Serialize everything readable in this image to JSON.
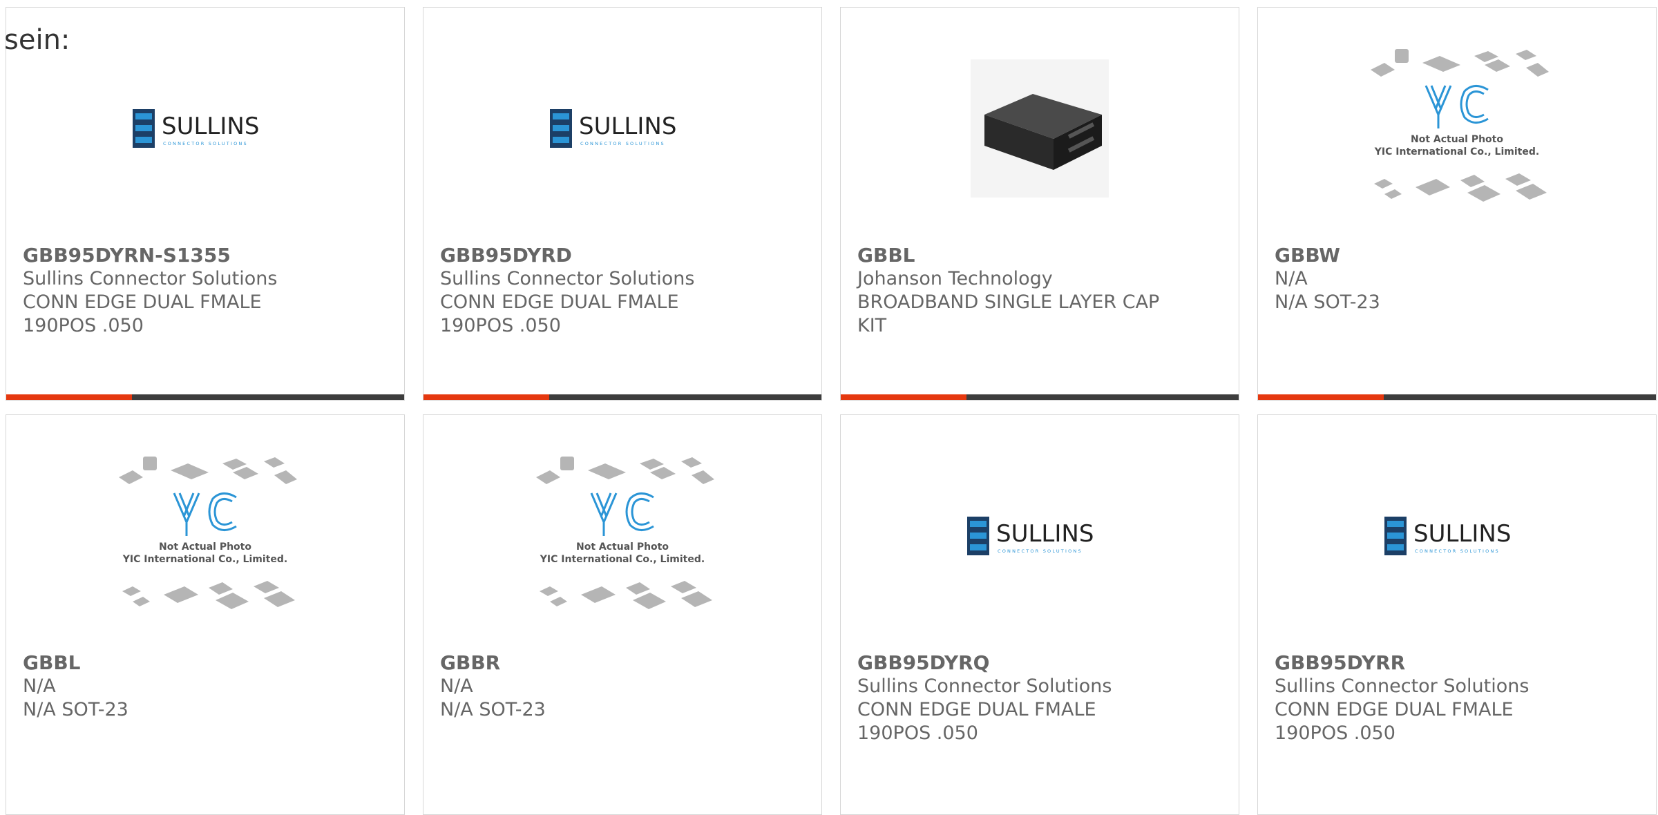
{
  "lead_text": "sein:",
  "products": [
    {
      "part": "GBB95DYRN-S1355",
      "manufacturer": "Sullins Connector Solutions",
      "desc1": "CONN EDGE DUAL FMALE",
      "desc2": "190POS .050",
      "image": "sullins-logo"
    },
    {
      "part": "GBB95DYRD",
      "manufacturer": "Sullins Connector Solutions",
      "desc1": "CONN EDGE DUAL FMALE",
      "desc2": "190POS .050",
      "image": "sullins-logo"
    },
    {
      "part": "GBBL",
      "manufacturer": "Johanson Technology",
      "desc1": "BROADBAND SINGLE LAYER CAP",
      "desc2": "KIT",
      "image": "component-photo"
    },
    {
      "part": "GBBW",
      "manufacturer": "N/A",
      "desc1": "N/A SOT-23",
      "desc2": "",
      "image": "yic-placeholder"
    },
    {
      "part": "GBBL",
      "manufacturer": "N/A",
      "desc1": "N/A SOT-23",
      "desc2": "",
      "image": "yic-placeholder"
    },
    {
      "part": "GBBR",
      "manufacturer": "N/A",
      "desc1": "N/A SOT-23",
      "desc2": "",
      "image": "yic-placeholder"
    },
    {
      "part": "GBB95DYRQ",
      "manufacturer": "Sullins Connector Solutions",
      "desc1": "CONN EDGE DUAL FMALE",
      "desc2": "190POS .050",
      "image": "sullins-logo"
    },
    {
      "part": "GBB95DYRR",
      "manufacturer": "Sullins Connector Solutions",
      "desc1": "CONN EDGE DUAL FMALE",
      "desc2": "190POS .050",
      "image": "sullins-logo"
    }
  ],
  "sullins_logo": {
    "name": "SULLINS",
    "tagline": "CONNECTOR SOLUTIONS"
  },
  "yic_placeholder": {
    "mark": "YIC",
    "line1": "Not Actual Photo",
    "line2": "YIC International Co., Limited."
  },
  "colors": {
    "accent": "#e5380f",
    "bar": "#3d3d3d",
    "text": "#666666",
    "border": "#d6d6d6",
    "logo_blue": "#1e88c8"
  }
}
